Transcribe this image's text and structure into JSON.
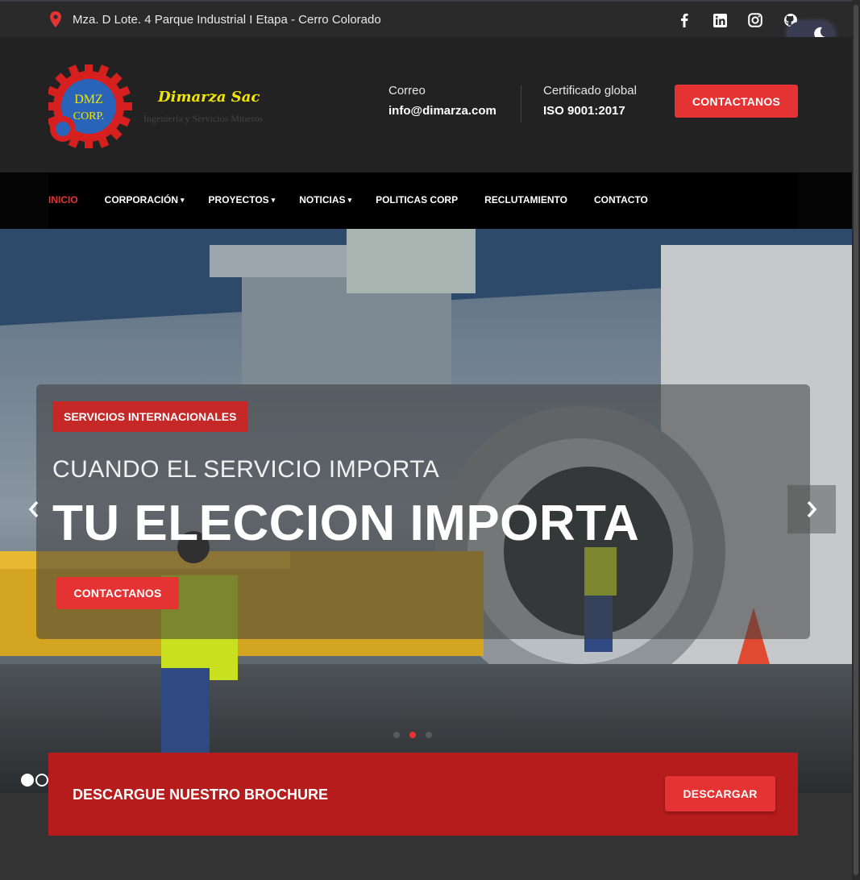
{
  "topbar": {
    "address": "Mza. D Lote. 4 Parque Industrial I Etapa - Cerro Colorado",
    "socials": [
      "facebook-icon",
      "linkedin-icon",
      "instagram-icon",
      "github-icon"
    ]
  },
  "header": {
    "logo_text_line1": "DMZ",
    "logo_text_line2": "CORP.",
    "brand_name": "Dimarza Sac",
    "brand_sub": "Ingeniería y Servicios Mineros",
    "email_label": "Correo",
    "email_value": "info@dimarza.com",
    "cert_label": "Certificado global",
    "cert_value": "ISO 9001:2017",
    "contact_button": "CONTACTANOS"
  },
  "nav": {
    "items": [
      {
        "label": "INICIO",
        "caret": ""
      },
      {
        "label": "CORPORACIÓN",
        "caret": "▾"
      },
      {
        "label": "PROYECTOS",
        "caret": "▾"
      },
      {
        "label": "NOTICIAS",
        "caret": "▾"
      },
      {
        "label": "POLITICAS CORP",
        "caret": ""
      },
      {
        "label": "RECLUTAMIENTO",
        "caret": ""
      },
      {
        "label": "CONTACTO",
        "caret": ""
      }
    ]
  },
  "hero": {
    "tag": "SERVICIOS INTERNACIONALES",
    "subtitle": "CUANDO EL SERVICIO IMPORTA",
    "title": "TU ELECCION IMPORTA",
    "button": "CONTACTANOS",
    "prev": "‹",
    "next": "›",
    "active_slide": 2,
    "slide_count": 3
  },
  "brochure": {
    "text": "DESCARGUE NUESTRO BROCHURE",
    "button": "DESCARGAR"
  },
  "colors": {
    "accent": "#e53232",
    "brochure_bg": "#b71c1c",
    "brand_yellow": "#f2e600"
  }
}
